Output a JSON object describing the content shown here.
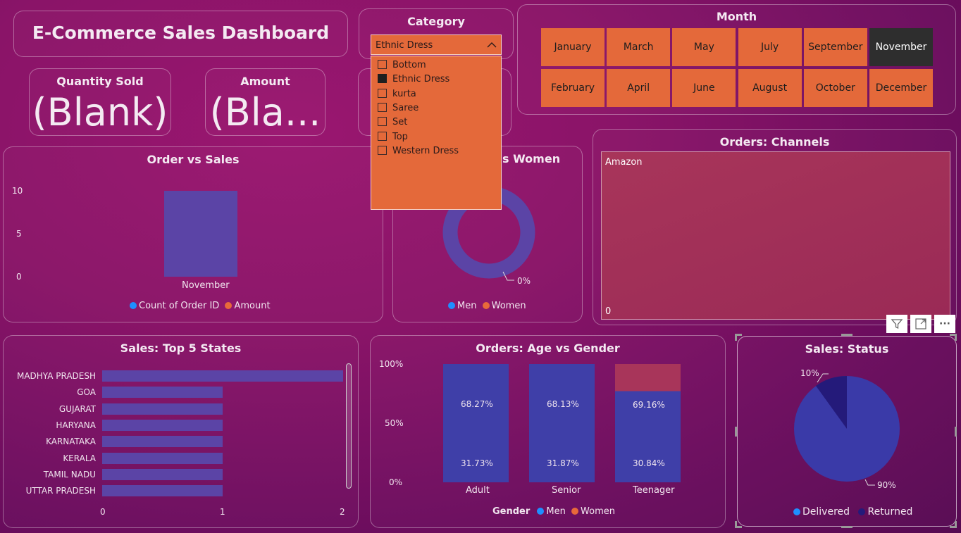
{
  "dashboard_title": "E-Commerce Sales Dashboard",
  "kpis": {
    "quantity": {
      "label": "Quantity Sold",
      "value": "(Blank)"
    },
    "amount": {
      "label": "Amount",
      "value": "(Bla..."
    }
  },
  "category_filter": {
    "label": "Category",
    "selected": "Ethnic Dress",
    "options": [
      {
        "label": "Bottom",
        "checked": false
      },
      {
        "label": "Ethnic Dress",
        "checked": true
      },
      {
        "label": "kurta",
        "checked": false
      },
      {
        "label": "Saree",
        "checked": false
      },
      {
        "label": "Set",
        "checked": false
      },
      {
        "label": "Top",
        "checked": false
      },
      {
        "label": "Western Dress",
        "checked": false
      }
    ]
  },
  "month_filter": {
    "label": "Month",
    "row1": [
      "January",
      "March",
      "May",
      "July",
      "September",
      "November"
    ],
    "row2": [
      "February",
      "April",
      "June",
      "August",
      "October",
      "December"
    ],
    "selected": "November"
  },
  "order_vs_sales": {
    "title": "Order vs Sales",
    "legend": [
      "Count of Order ID",
      "Amount"
    ]
  },
  "men_vs_women": {
    "title_partial": "s Women",
    "data_label": "0%",
    "legend": [
      "Men",
      "Women"
    ]
  },
  "channels": {
    "title": "Orders: Channels",
    "tile_label": "Amazon",
    "value_label": "0"
  },
  "top_states": {
    "title": "Sales: Top 5 States"
  },
  "age_gender": {
    "title": "Orders: Age vs Gender",
    "legend_title": "Gender",
    "legend": [
      "Men",
      "Women"
    ]
  },
  "status": {
    "title": "Sales: Status",
    "legend": [
      "Delivered",
      "Returned"
    ]
  },
  "toolbar": {
    "filter_icon": "filter-icon",
    "focus_icon": "focus-mode-icon",
    "more_label": "···"
  },
  "colors": {
    "men": "#1e8fff",
    "women": "#e8693a",
    "bar": "#5b44a6",
    "orange": "#e4693a",
    "pie_main": "#3a3aa8",
    "pie_small": "#241a7a"
  },
  "chart_data": [
    {
      "type": "bar",
      "title": "Order vs Sales",
      "categories": [
        "November"
      ],
      "series": [
        {
          "name": "Count of Order ID",
          "values": [
            10
          ]
        }
      ],
      "ylim": [
        0,
        10
      ],
      "yticks": [
        "10",
        "5",
        "0"
      ]
    },
    {
      "type": "pie",
      "title": "s Women",
      "labels": [
        "Men",
        "Women"
      ],
      "values": [
        100,
        0
      ],
      "data_labels": [
        "0%"
      ]
    },
    {
      "type": "bar",
      "title": "Sales: Top 5 States",
      "orientation": "horizontal",
      "categories": [
        "MADHYA PRADESH",
        "GOA",
        "GUJARAT",
        "HARYANA",
        "KARNATAKA",
        "KERALA",
        "TAMIL NADU",
        "UTTAR PRADESH"
      ],
      "values": [
        2,
        1,
        1,
        1,
        1,
        1,
        1,
        1
      ],
      "xlim": [
        0,
        2
      ],
      "xticks": [
        "0",
        "1",
        "2"
      ]
    },
    {
      "type": "bar",
      "stacked": "percent",
      "title": "Orders: Age vs Gender",
      "categories": [
        "Adult",
        "Senior",
        "Teenager"
      ],
      "yticks": [
        "100%",
        "50%",
        "0%"
      ],
      "series": [
        {
          "name": "Men",
          "values": [
            68.27,
            68.13,
            69.16
          ],
          "labels": [
            "68.27%",
            "68.13%",
            "69.16%"
          ]
        },
        {
          "name": "Women",
          "values": [
            31.73,
            31.87,
            30.84
          ],
          "labels": [
            "31.73%",
            "31.87%",
            "30.84%"
          ]
        }
      ]
    },
    {
      "type": "pie",
      "title": "Sales: Status",
      "labels": [
        "Delivered",
        "Returned"
      ],
      "values": [
        90,
        10
      ],
      "data_labels": [
        "90%",
        "10%"
      ]
    }
  ]
}
